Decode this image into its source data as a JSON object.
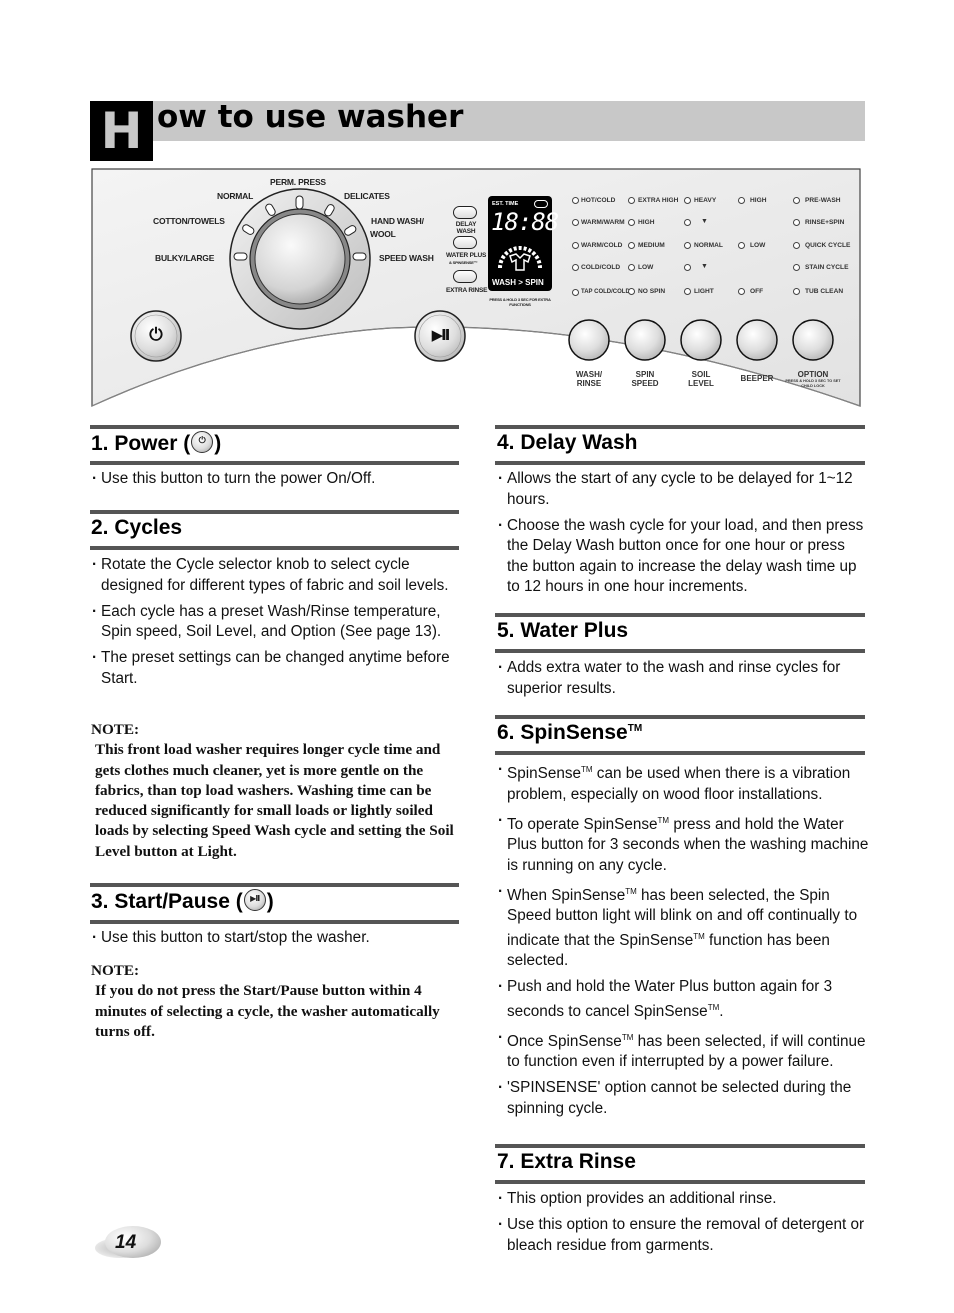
{
  "title": {
    "cap_letter": "H",
    "rest": "ow to use washer"
  },
  "panel": {
    "dial_labels": {
      "perm_press": "PERM. PRESS",
      "normal": "NORMAL",
      "delicates": "DELICATES",
      "cotton_towels": "COTTON/TOWELS",
      "hand_wash": "HAND WASH/",
      "wool": "WOOL",
      "bulky_large": "BULKY/LARGE",
      "speed_wash": "SPEED WASH"
    },
    "small_buttons": {
      "delay_wash": "DELAY WASH",
      "water_plus": "WATER PLUS",
      "water_plus_sub": "& SPINSENSE™",
      "extra_rinse": "EXTRA RINSE"
    },
    "display": {
      "est_time": "EST. TIME",
      "digits": "18:88",
      "wash_spin": "WASH > SPIN",
      "footnote": "PRESS & HOLD 3 SEC FOR EXTRA FUNCTIONS"
    },
    "led_columns": {
      "temperature": [
        "HOT/COLD",
        "WARM/WARM",
        "WARM/COLD",
        "COLD/COLD",
        "TAP COLD/COLD"
      ],
      "spin": [
        "EXTRA HIGH",
        "HIGH",
        "MEDIUM",
        "LOW",
        "NO SPIN"
      ],
      "soil": [
        "HEAVY",
        "▼",
        "NORMAL",
        "▼",
        "LIGHT"
      ],
      "beeper": [
        "HIGH",
        "LOW",
        "OFF"
      ],
      "option": [
        "PRE-WASH",
        "RINSE+SPIN",
        "QUICK CYCLE",
        "STAIN CYCLE",
        "TUB CLEAN"
      ]
    },
    "round_buttons": [
      {
        "label": "WASH/\nRINSE",
        "line1": "WASH/",
        "line2": "RINSE"
      },
      {
        "label": "SPIN SPEED",
        "line1": "SPIN",
        "line2": "SPEED"
      },
      {
        "label": "SOIL LEVEL",
        "line1": "SOIL",
        "line2": "LEVEL"
      },
      {
        "label": "BEEPER",
        "line1": "BEEPER",
        "line2": ""
      },
      {
        "label": "OPTION",
        "line1": "OPTION",
        "line2": ""
      }
    ],
    "option_sub": "PRESS & HOLD 3 SEC TO SET CHILD LOCK",
    "power_glyph": "⏻",
    "start_glyph": "▶II"
  },
  "sections": {
    "power": {
      "number_title": "1. Power (",
      "close": ")",
      "bullets": [
        "Use this button to turn the power On/Off."
      ]
    },
    "cycles": {
      "title": "2. Cycles",
      "bullets": [
        "Rotate the Cycle selector knob  to select cycle designed for different types of fabric and soil levels.",
        "Each cycle has a preset Wash/Rinse temperature, Spin speed, Soil Level, and Option (See page 13).",
        "The preset settings can be changed anytime before Start."
      ],
      "note_label": "NOTE:",
      "note_body": "This front load washer requires longer cycle time and gets clothes much cleaner, yet is more gentle on the fabrics, than top load washers. Washing time can be reduced significantly for small loads or lightly soiled loads by selecting Speed Wash cycle and setting the Soil Level button at Light."
    },
    "start_pause": {
      "number_title": "3. Start/Pause (",
      "close": ")",
      "bullets": [
        "Use this button to start/stop the washer."
      ],
      "note_label": "NOTE:",
      "note_body": "If you do not press the Start/Pause button within 4 minutes of selecting a cycle, the washer automatically turns off."
    },
    "delay_wash": {
      "title": "4. Delay Wash",
      "bullets": [
        "Allows the start of any cycle to be delayed for 1~12 hours.",
        "Choose the wash cycle for your load,  and then press the Delay Wash button once for one hour or press the button again to increase the delay wash time up to 12 hours in one hour increments."
      ]
    },
    "water_plus": {
      "title": "5. Water Plus",
      "bullets": [
        "Adds extra water to the wash and rinse cycles for superior results."
      ]
    },
    "spinsense": {
      "title": "6. SpinSense",
      "tm": "TM",
      "bullets": [
        {
          "pre": "SpinSense",
          "post": " can be used when there is a vibration problem, especially on wood floor installations."
        },
        {
          "pre": "To operate SpinSense",
          "post": " press and hold the Water Plus button for 3 seconds when the washing machine is running on any cycle."
        },
        {
          "pre": "When SpinSense",
          "post": " has been selected, the Spin Speed button light will blink on and off continually to indicate that the SpinSense",
          "post2": " function has been selected."
        },
        {
          "pre": "Push and hold the Water Plus button again for 3 seconds to cancel SpinSense",
          "post": "."
        },
        {
          "pre": "Once SpinSense",
          "post": " has been selected, if will continue to function even if interrupted by a power failure."
        },
        {
          "pre": "'SPINSENSE' option cannot be selected during the spinning cycle.",
          "post": ""
        }
      ]
    },
    "extra_rinse": {
      "title": "7. Extra Rinse",
      "bullets": [
        "This option provides an additional rinse.",
        "Use this option to ensure the removal of detergent or bleach residue from garments."
      ]
    }
  },
  "page_number": "14"
}
